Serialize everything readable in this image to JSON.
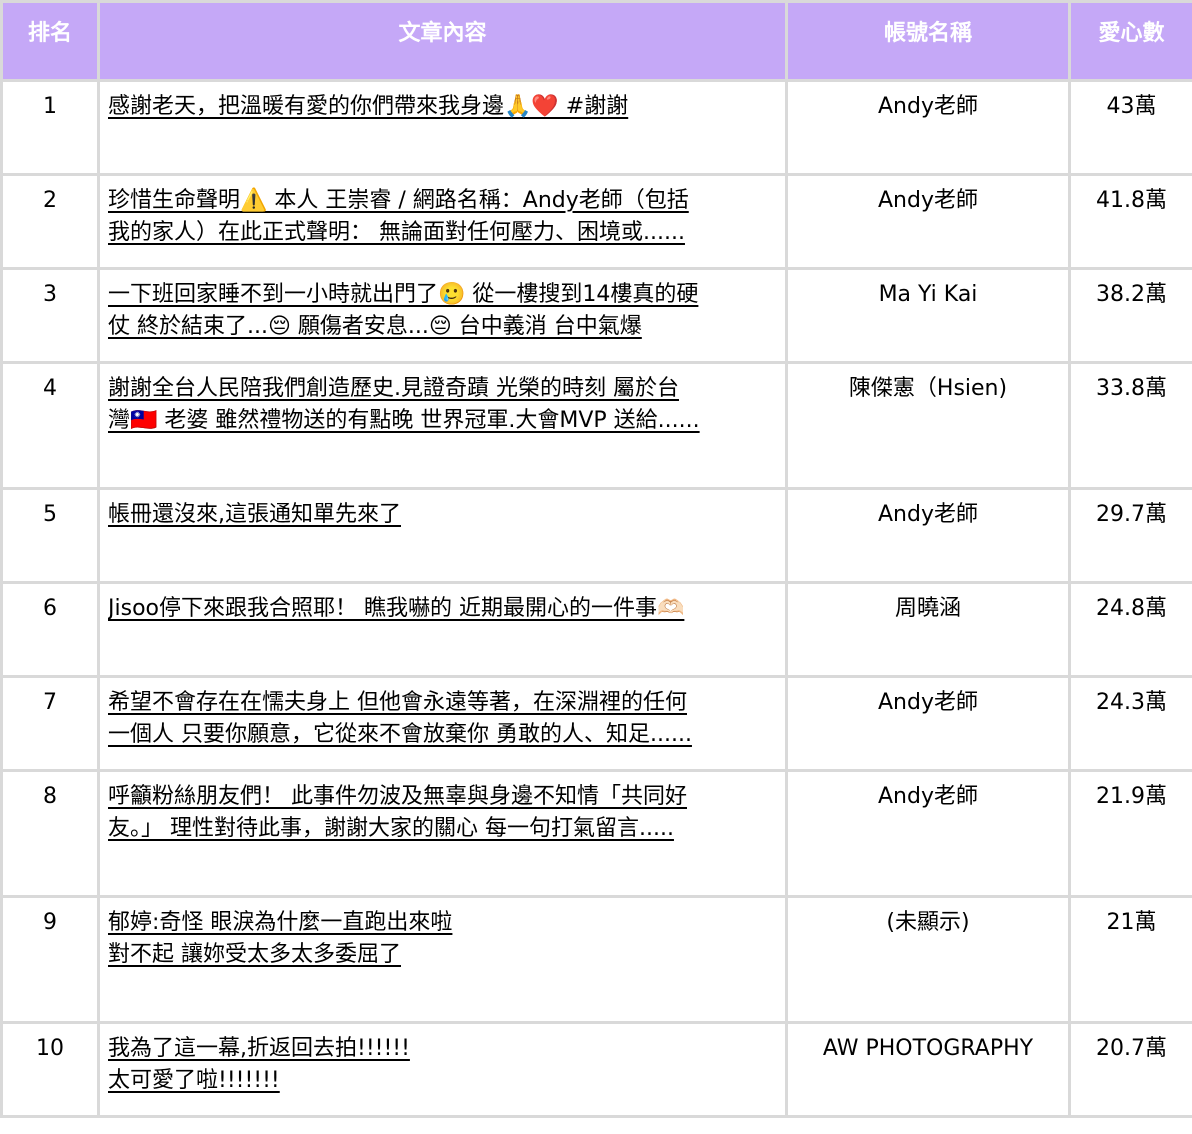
{
  "header": {
    "rank": "排名",
    "content": "文章內容",
    "account": "帳號名稱",
    "likes": "愛心數"
  },
  "rows": [
    {
      "rank": "1",
      "lines": [
        "感謝老天，把溫暖有愛的你們帶來我身邊🙏❤️ #謝謝"
      ],
      "account": "Andy老師",
      "likes": "43萬"
    },
    {
      "rank": "2",
      "lines": [
        "珍惜生命聲明⚠️ 本人 王崇睿 / 網路名稱：Andy老師（包括",
        "我的家人）在此正式聲明： 無論面對任何壓力、困境或......"
      ],
      "account": "Andy老師",
      "likes": "41.8萬"
    },
    {
      "rank": "3",
      "lines": [
        "一下班回家睡不到一小時就出門了🥲 從一樓搜到14樓真的硬",
        "仗 終於結束了...😔 願傷者安息...😔 台中義消 台中氣爆"
      ],
      "account": "Ma Yi Kai",
      "likes": "38.2萬"
    },
    {
      "rank": "4",
      "lines": [
        "謝謝全台人民陪我們創造歷史.見證奇蹟 光榮的時刻 屬於台",
        "灣🇹🇼 老婆 雖然禮物送的有點晚 世界冠軍.大會MVP 送給......"
      ],
      "account": "陳傑憲（Hsien)",
      "likes": "33.8萬"
    },
    {
      "rank": "5",
      "lines": [
        "帳冊還沒來,這張通知單先來了"
      ],
      "account": "Andy老師",
      "likes": "29.7萬"
    },
    {
      "rank": "6",
      "lines": [
        "Jisoo停下來跟我合照耶！ 瞧我嚇的 近期最開心的一件事🫶🏻"
      ],
      "account": "周曉涵",
      "likes": "24.8萬"
    },
    {
      "rank": "7",
      "lines": [
        "希望不會存在在懦夫身上 但他會永遠等著，在深淵裡的任何",
        "一個人 只要你願意，它從來不會放棄你 勇敢的人、知足......"
      ],
      "account": "Andy老師",
      "likes": "24.3萬"
    },
    {
      "rank": "8",
      "lines": [
        "呼籲粉絲朋友們！ 此事件勿波及無辜與身邊不知情「共同好",
        "友。」 理性對待此事，謝謝大家的關心 每一句打氣留言....."
      ],
      "account": "Andy老師",
      "likes": "21.9萬"
    },
    {
      "rank": "9",
      "lines": [
        "郁婷:奇怪 眼淚為什麼一直跑出來啦",
        "對不起 讓妳受太多太多委屈了"
      ],
      "account": "(未顯示)",
      "likes": "21萬"
    },
    {
      "rank": "10",
      "lines": [
        "我為了這一幕,折返回去拍!!!!!!",
        "太可愛了啦!!!!!!!"
      ],
      "account": "AW PHOTOGRAPHY",
      "likes": "20.7萬"
    }
  ]
}
